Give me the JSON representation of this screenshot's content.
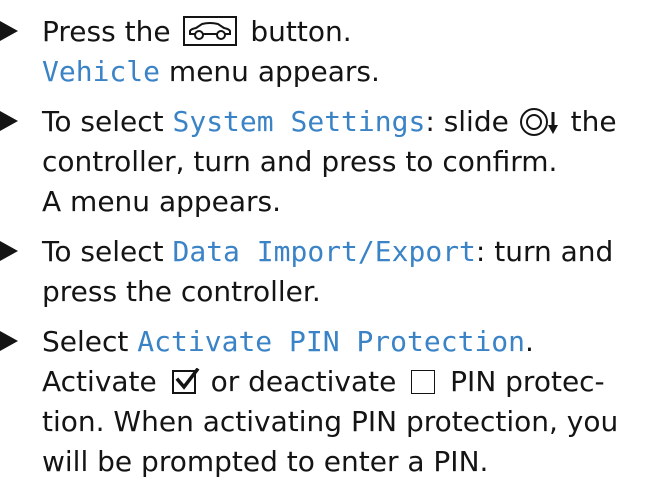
{
  "steps": [
    {
      "press_prefix": "Press the",
      "press_suffix": "button.",
      "result_ui": "Vehicle",
      "result_suffix": "menu appears."
    },
    {
      "prefix": "To select",
      "ui": "System Settings",
      "mid": ": slide",
      "suffix": "the",
      "line2": "controller, turn and press to confirm.",
      "line3": "A menu appears."
    },
    {
      "prefix": "To select",
      "ui": "Data Import/Export",
      "suffix": ": turn and",
      "line2": "press the controller."
    },
    {
      "prefix": "Select",
      "ui": "Activate PIN Protection",
      "suffix": ".",
      "line2_a": "Activate",
      "line2_b": "or deactivate",
      "line2_c": "PIN protec-",
      "line3": "tion. When activating PIN protection, you",
      "line4": "will be prompted to enter a PIN."
    }
  ],
  "icons": {
    "car_button": "car-icon",
    "controller": "controller-slide-down-icon",
    "checked": "checkbox-checked-icon",
    "unchecked": "checkbox-unchecked-icon"
  },
  "colors": {
    "text": "#141414",
    "ui_term": "#3a83c6"
  }
}
